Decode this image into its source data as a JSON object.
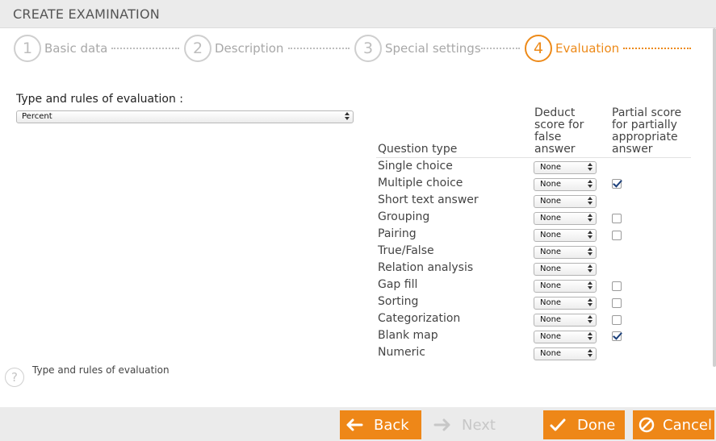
{
  "header": {
    "title": "CREATE EXAMINATION"
  },
  "steps": [
    {
      "number": "1",
      "label": "Basic data"
    },
    {
      "number": "2",
      "label": "Description"
    },
    {
      "number": "3",
      "label": "Special settings"
    },
    {
      "number": "4",
      "label": "Evaluation"
    }
  ],
  "evaluation": {
    "type_label": "Type and rules of evaluation :",
    "type_value": "Percent"
  },
  "table": {
    "col_question_type": "Question type",
    "col_deduct_lines": [
      "Deduct",
      "score for",
      "false",
      "answer"
    ],
    "col_partial_lines": [
      "Partial score",
      "for partially",
      "appropriate",
      "answer"
    ],
    "rows": [
      {
        "type": "Single choice",
        "deduct": "None",
        "partial": null
      },
      {
        "type": "Multiple choice",
        "deduct": "None",
        "partial": true
      },
      {
        "type": "Short text answer",
        "deduct": "None",
        "partial": null
      },
      {
        "type": "Grouping",
        "deduct": "None",
        "partial": false
      },
      {
        "type": "Pairing",
        "deduct": "None",
        "partial": false
      },
      {
        "type": "True/False",
        "deduct": "None",
        "partial": null
      },
      {
        "type": "Relation analysis",
        "deduct": "None",
        "partial": null
      },
      {
        "type": "Gap fill",
        "deduct": "None",
        "partial": false
      },
      {
        "type": "Sorting",
        "deduct": "None",
        "partial": false
      },
      {
        "type": "Categorization",
        "deduct": "None",
        "partial": false
      },
      {
        "type": "Blank map",
        "deduct": "None",
        "partial": true
      },
      {
        "type": "Numeric",
        "deduct": "None",
        "partial": null
      }
    ]
  },
  "help": {
    "icon": "question-icon",
    "glyph": "?",
    "text": "Type and rules of evaluation"
  },
  "footer": {
    "back_label": "Back",
    "next_label": "Next",
    "done_label": "Done",
    "cancel_label": "Cancel"
  },
  "colors": {
    "accent": "#ee8718",
    "muted": "#bdbdbd",
    "bar": "#ebebeb"
  }
}
